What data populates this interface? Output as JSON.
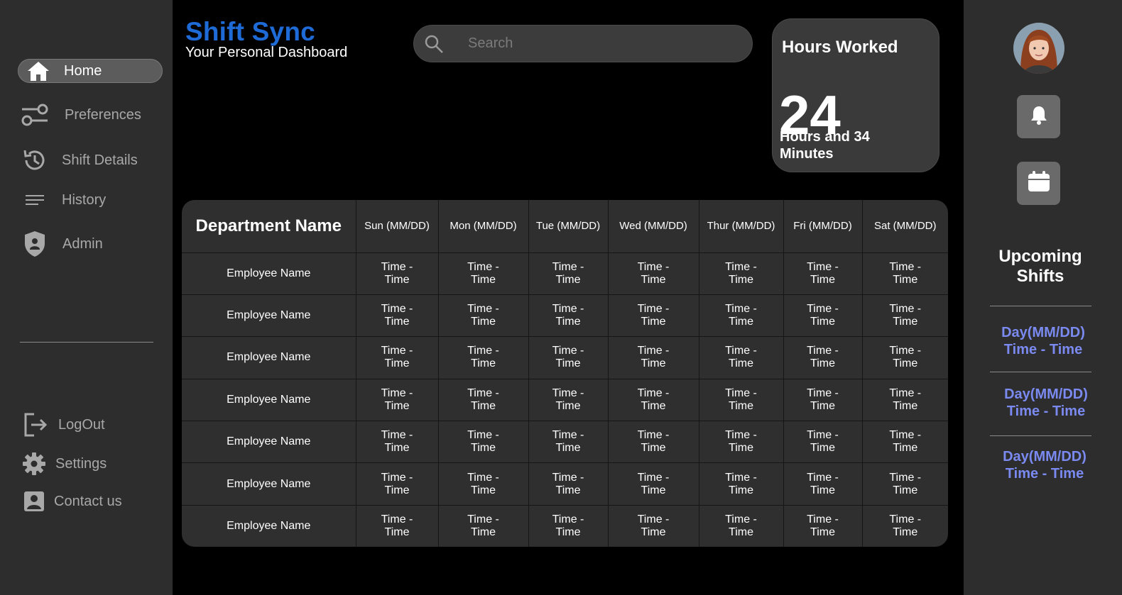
{
  "brand": {
    "title": "Shift Sync",
    "subtitle": "Your Personal Dashboard",
    "accent": "#1e6ad6"
  },
  "nav": {
    "items": [
      {
        "label": "Home",
        "icon": "home-icon",
        "active": true
      },
      {
        "label": "Preferences",
        "icon": "sliders-icon"
      },
      {
        "label": "Shift Details",
        "icon": "history-icon"
      },
      {
        "label": "History",
        "icon": "lines-icon"
      },
      {
        "label": "Admin",
        "icon": "shield-icon"
      }
    ],
    "bottom": [
      {
        "label": "LogOut",
        "icon": "logout-icon"
      },
      {
        "label": "Settings",
        "icon": "gear-icon"
      },
      {
        "label": "Contact us",
        "icon": "contact-icon"
      }
    ]
  },
  "search": {
    "placeholder": "Search",
    "icon": "search-icon"
  },
  "hours": {
    "title": "Hours Worked",
    "value": "24",
    "subtitle": "Hours and 34 Minutes"
  },
  "schedule": {
    "headers": [
      "Department Name",
      "Sun (MM/DD)",
      "Mon (MM/DD)",
      "Tue (MM/DD)",
      "Wed (MM/DD)",
      "Thur (MM/DD)",
      "Fri (MM/DD)",
      "Sat (MM/DD)"
    ],
    "rows": [
      {
        "name": "Employee Name",
        "cells": [
          "Time - Time",
          "Time - Time",
          "Time - Time",
          "Time - Time",
          "Time - Time",
          "Time - Time",
          "Time - Time"
        ]
      },
      {
        "name": "Employee Name",
        "cells": [
          "Time - Time",
          "Time - Time",
          "Time - Time",
          "Time - Time",
          "Time - Time",
          "Time - Time",
          "Time - Time"
        ]
      },
      {
        "name": "Employee Name",
        "cells": [
          "Time - Time",
          "Time - Time",
          "Time - Time",
          "Time - Time",
          "Time - Time",
          "Time - Time",
          "Time - Time"
        ]
      },
      {
        "name": "Employee Name",
        "cells": [
          "Time - Time",
          "Time - Time",
          "Time - Time",
          "Time - Time",
          "Time - Time",
          "Time - Time",
          "Time - Time"
        ]
      },
      {
        "name": "Employee Name",
        "cells": [
          "Time - Time",
          "Time - Time",
          "Time - Time",
          "Time - Time",
          "Time - Time",
          "Time - Time",
          "Time - Time"
        ]
      },
      {
        "name": "Employee Name",
        "cells": [
          "Time - Time",
          "Time - Time",
          "Time - Time",
          "Time - Time",
          "Time - Time",
          "Time - Time",
          "Time - Time"
        ]
      },
      {
        "name": "Employee Name",
        "cells": [
          "Time - Time",
          "Time - Time",
          "Time - Time",
          "Time - Time",
          "Time - Time",
          "Time - Time",
          "Time - Time"
        ]
      }
    ]
  },
  "right": {
    "avatar_icon": "avatar",
    "notification_icon": "bell-icon",
    "calendar_icon": "calendar-icon",
    "upcoming_title": "Upcoming Shifts",
    "shifts": [
      {
        "day": "Day(MM/DD)",
        "time": "Time - Time"
      },
      {
        "day": "Day(MM/DD)",
        "time": "Time - Time"
      },
      {
        "day": "Day(MM/DD)",
        "time": "Time - Time"
      }
    ],
    "shift_color": "#7a8af0"
  }
}
